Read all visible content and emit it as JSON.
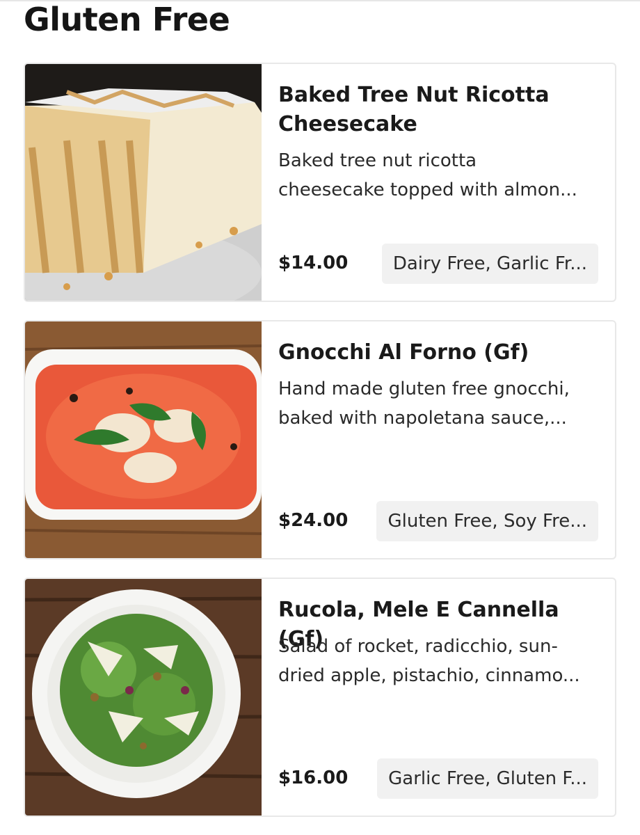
{
  "section": {
    "title": "Gluten Free"
  },
  "items": [
    {
      "name": "Baked Tree Nut Ricotta\nCheesecake",
      "description": "Baked tree nut ricotta\ncheesecake topped with almon...",
      "price": "$14.00",
      "tags": "Dairy Free, Garlic Fr...",
      "image": "cheesecake-photo"
    },
    {
      "name": "Gnocchi Al Forno (Gf)",
      "description": "Hand made gluten free gnocchi,\nbaked with napoletana sauce,...",
      "price": "$24.00",
      "tags": "Gluten Free, Soy Fre...",
      "image": "gnocchi-photo"
    },
    {
      "name": "Rucola, Mele E Cannella (Gf)",
      "description": "Salad of rocket, radicchio, sun-\ndried apple, pistachio, cinnamo...",
      "price": "$16.00",
      "tags": "Garlic Free, Gluten F...",
      "image": "salad-photo"
    }
  ],
  "colors": {
    "card_border": "#e8e8e8",
    "tag_bg": "#f1f1f1",
    "text": "#1a1a1a"
  }
}
